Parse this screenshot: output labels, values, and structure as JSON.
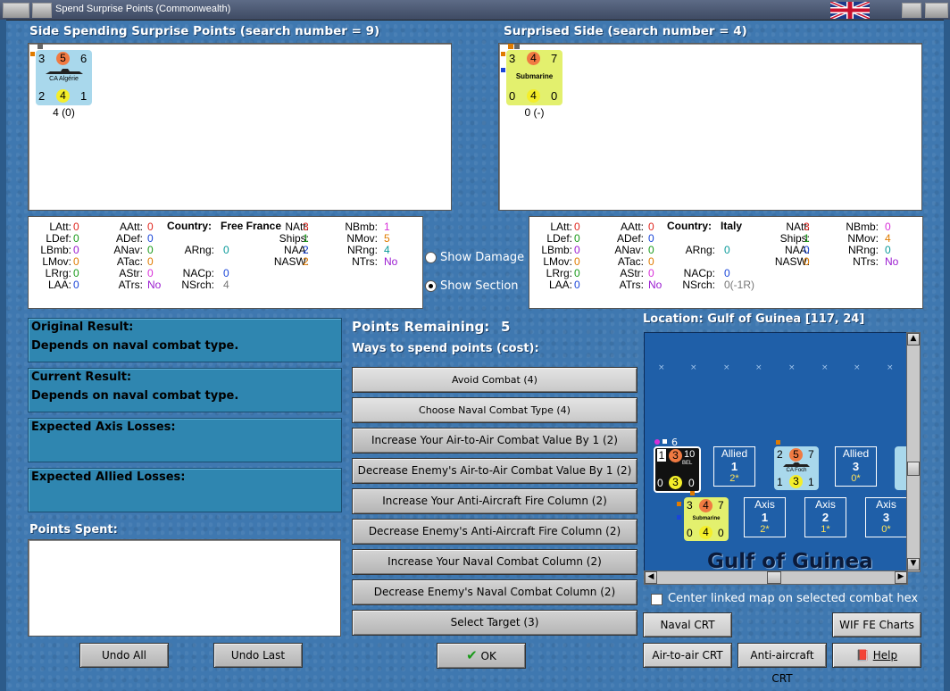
{
  "window": {
    "title": "Spend Surprise Points (Commonwealth)"
  },
  "colors": {
    "background": "#3f78b0",
    "info_panel": "#2f86b0",
    "map_sea": "#1f5fa8",
    "red": "#e0271f",
    "green": "#1a9a1a",
    "blue": "#1a46d8",
    "orange": "#e07b00",
    "purple": "#9a1ad0",
    "magenta": "#d82fd8",
    "teal": "#0a9a9a",
    "grey": "#777777"
  },
  "left_panel": {
    "header": "Side Spending Surprise Points (search number = 9)",
    "unit": {
      "top_left": "3",
      "top_mid": "5",
      "top_right": "6",
      "name": "CA Algérie",
      "bot_left": "2",
      "bot_mid": "4",
      "bot_right": "1",
      "caption": "4 (0)"
    }
  },
  "right_panel": {
    "header": "Surprised Side (search number = 4)",
    "unit": {
      "top_left": "3",
      "top_mid": "4",
      "top_right": "7",
      "name": "Submarine",
      "bot_left": "0",
      "bot_mid": "4",
      "bot_right": "0",
      "caption": "0 (-)"
    }
  },
  "left_stats": {
    "country_label": "Country:",
    "country": "Free France",
    "l_labels": [
      "LAtt:",
      "LDef:",
      "LBmb:",
      "LMov:",
      "LRrg:",
      "LAA:"
    ],
    "l_values": [
      "0",
      "0",
      "0",
      "0",
      "0",
      "0"
    ],
    "a_labels": [
      "AAtt:",
      "ADef:",
      "ANav:",
      "ATac:",
      "AStr:",
      "ATrs:"
    ],
    "a_values": [
      "0",
      "0",
      "0",
      "0",
      "0",
      "No"
    ],
    "m_labels": [
      "ARng:",
      "NACp:",
      "NSrch:"
    ],
    "m_values": [
      "0",
      "0",
      "4"
    ],
    "n_labels": [
      "NAtt:",
      "Ships:",
      "NAA:",
      "NASW:"
    ],
    "n_values": [
      "3",
      "1",
      "2",
      "2"
    ],
    "r_labels": [
      "NBmb:",
      "NMov:",
      "NRng:",
      "NTrs:"
    ],
    "r_values": [
      "1",
      "5",
      "4",
      "No"
    ]
  },
  "right_stats": {
    "country_label": "Country:",
    "country": "Italy",
    "l_labels": [
      "LAtt:",
      "LDef:",
      "LBmb:",
      "LMov:",
      "LRrg:",
      "LAA:"
    ],
    "l_values": [
      "0",
      "0",
      "0",
      "0",
      "0",
      "0"
    ],
    "a_labels": [
      "AAtt:",
      "ADef:",
      "ANav:",
      "ATac:",
      "AStr:",
      "ATrs:"
    ],
    "a_values": [
      "0",
      "0",
      "0",
      "0",
      "0",
      "No"
    ],
    "m_labels": [
      "ARng:",
      "NACp:",
      "NSrch:"
    ],
    "m_values": [
      "0",
      "0",
      "0(-1R)"
    ],
    "n_labels": [
      "NAtt:",
      "Ships:",
      "NAA:",
      "NASW:"
    ],
    "n_values": [
      "3",
      "1",
      "0",
      "0"
    ],
    "r_labels": [
      "NBmb:",
      "NMov:",
      "NRng:",
      "NTrs:"
    ],
    "r_values": [
      "0",
      "4",
      "0",
      "No"
    ]
  },
  "radios": {
    "show_damage": "Show Damage",
    "show_section": "Show Section",
    "selected": "Show Section"
  },
  "results": {
    "original_title": "Original Result:",
    "original_value": "Depends on naval combat type.",
    "current_title": "Current Result:",
    "current_value": "Depends on naval combat type.",
    "axis_losses_title": "Expected Axis Losses:",
    "allied_losses_title": "Expected Allied Losses:",
    "points_spent_title": "Points Spent:"
  },
  "spend": {
    "points_label": "Points Remaining:",
    "points_value": "5",
    "ways_label": "Ways to spend points (cost):",
    "options": [
      "Avoid Combat (4)",
      "Choose Naval Combat Type (4)",
      "Increase Your Air-to-Air Combat Value By 1 (2)",
      "Decrease Enemy's Air-to-Air Combat Value By 1 (2)",
      "Increase Your Anti-Aircraft Fire Column (2)",
      "Decrease Enemy's Anti-Aircraft Fire Column (2)",
      "Increase Your Naval Combat Column (2)",
      "Decrease Enemy's Naval Combat Column (2)",
      "Select Target (3)"
    ]
  },
  "map": {
    "location": "Location: Gulf of Guinea [117, 24]",
    "sea_name": "Gulf of Guinea",
    "center_checkbox": "Center linked map on selected combat hex",
    "allied_markers": [
      {
        "label": "Allied",
        "num": "1",
        "sub": "2*"
      },
      {
        "label": "Allied",
        "num": "3",
        "sub": "0*"
      }
    ],
    "axis_markers": [
      {
        "label": "Axis",
        "num": "1",
        "sub": "2*"
      },
      {
        "label": "Axis",
        "num": "2",
        "sub": "1*"
      },
      {
        "label": "Axis",
        "num": "3",
        "sub": "0*"
      }
    ],
    "bel_unit": {
      "stack": "6",
      "a": "1",
      "b": "3",
      "c": "10",
      "tag": "BEL",
      "d": "0",
      "e": "3",
      "f": "0"
    },
    "foch_unit": {
      "a": "2",
      "b": "5",
      "c": "7",
      "name": "CA Foch",
      "d": "1",
      "e": "3",
      "f": "1"
    },
    "sub_unit": {
      "a": "3",
      "b": "4",
      "c": "7",
      "name": "Submarine",
      "d": "0",
      "e": "4",
      "f": "0"
    }
  },
  "buttons": {
    "undo_all": "Undo All",
    "undo_last": "Undo Last",
    "ok": "OK",
    "naval_crt": "Naval CRT",
    "wif_charts": "WIF FE Charts",
    "air_crt": "Air-to-air CRT",
    "aa_crt": "Anti-aircraft CRT",
    "help": "Help"
  }
}
